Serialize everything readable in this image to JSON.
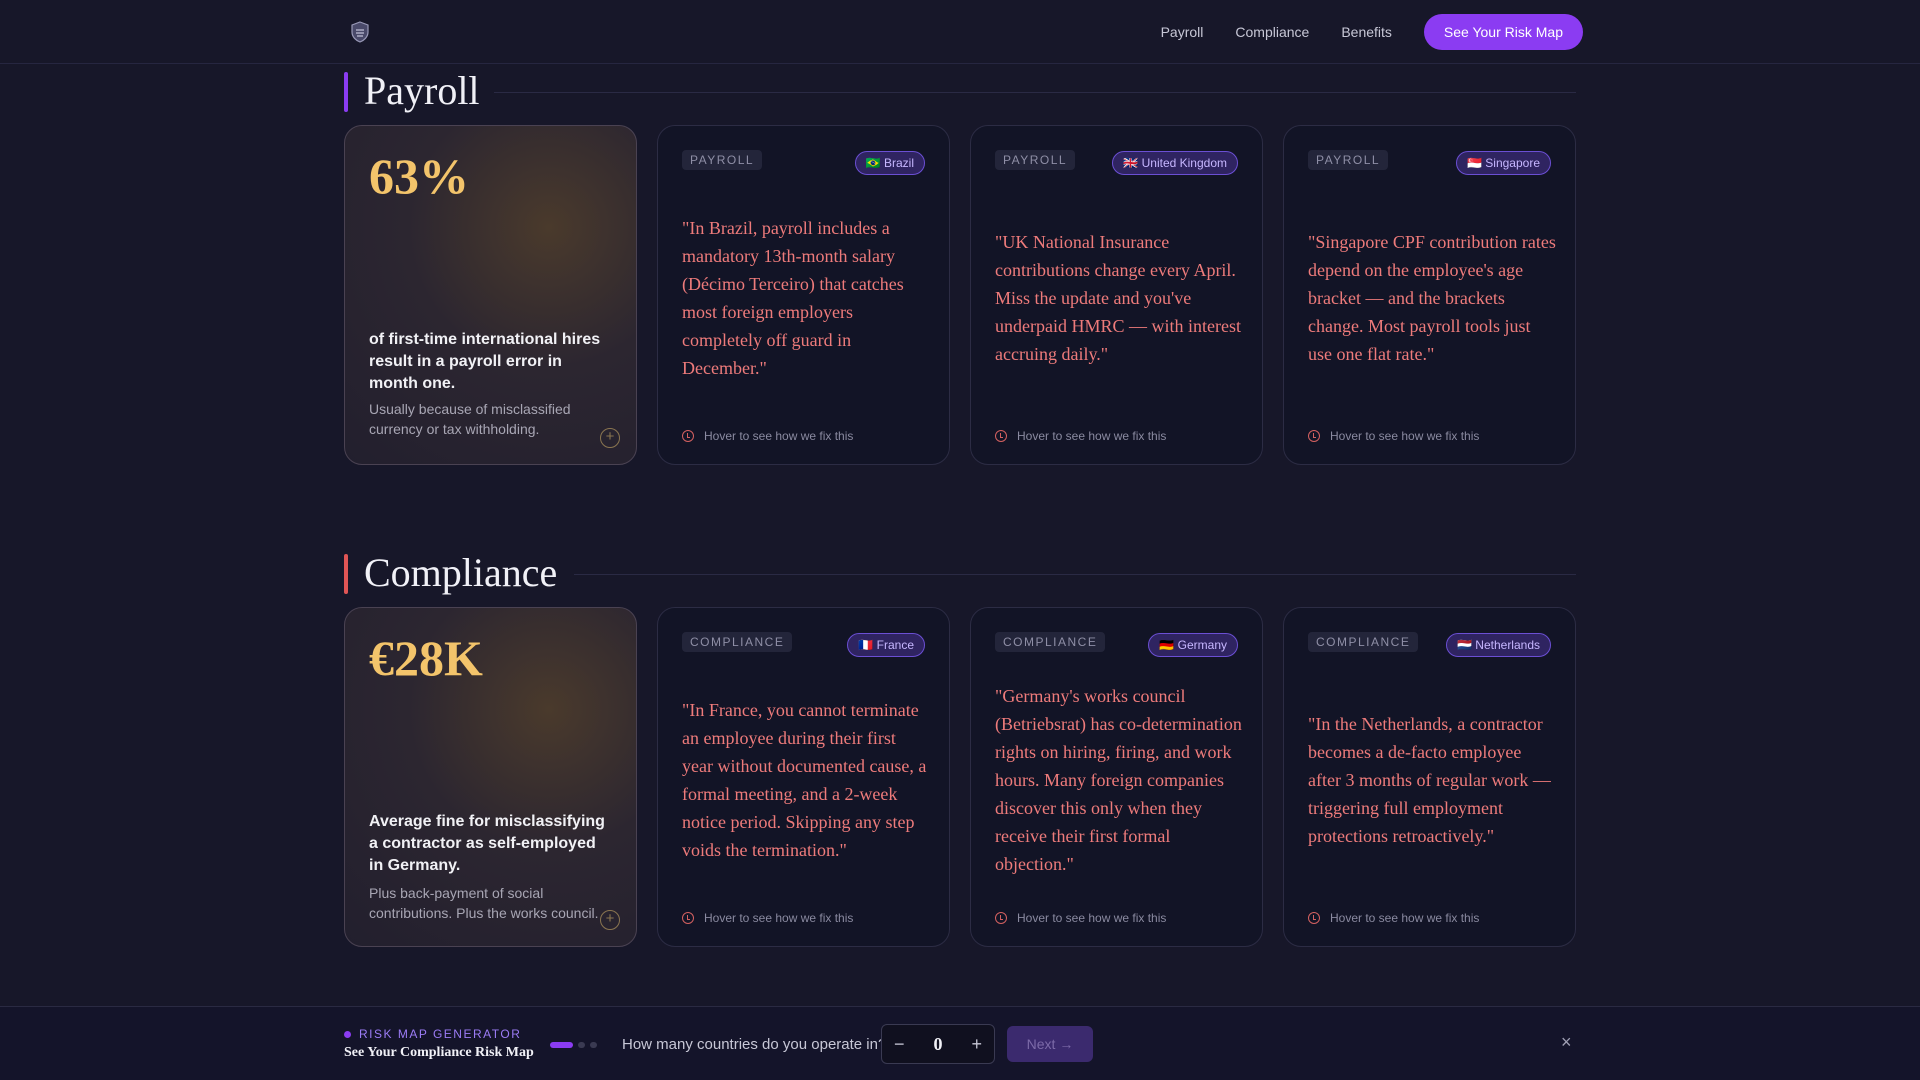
{
  "nav": {
    "logo": "shield-logo",
    "links": [
      "Payroll",
      "Compliance",
      "Benefits"
    ],
    "cta": "See Your Risk Map"
  },
  "colors": {
    "accent": "#8b3cf2",
    "payroll_bar": "#8b3cf2",
    "compliance_bar": "#e05555",
    "stat": "#f3c46b",
    "quote": "#ee7b7b"
  },
  "sections": [
    {
      "title": "Payroll",
      "stat": {
        "value": "63%",
        "description": "of first-time international hires result in a payroll error in month one.",
        "sub": "Usually because of misclassified currency or tax withholding."
      },
      "cards": [
        {
          "tag": "PAYROLL",
          "country": "🇧🇷 Brazil",
          "quote": "\"In Brazil, payroll includes a mandatory 13th-month salary (Décimo Terceiro) that catches most foreign employers completely off guard in December.\"",
          "hint": "Hover to see how we fix this"
        },
        {
          "tag": "PAYROLL",
          "country": "🇬🇧 United Kingdom",
          "quote": "\"UK National Insurance contributions change every April. Miss the update and you've underpaid HMRC — with interest accruing daily.\"",
          "hint": "Hover to see how we fix this"
        },
        {
          "tag": "PAYROLL",
          "country": "🇸🇬 Singapore",
          "quote": "\"Singapore CPF contribution rates depend on the employee's age bracket — and the brackets change. Most payroll tools just use one flat rate.\"",
          "hint": "Hover to see how we fix this"
        }
      ]
    },
    {
      "title": "Compliance",
      "stat": {
        "value": "€28K",
        "description": "Average fine for misclassifying a contractor as self-employed in Germany.",
        "sub": "Plus back-payment of social contributions. Plus the works council."
      },
      "cards": [
        {
          "tag": "COMPLIANCE",
          "country": "🇫🇷 France",
          "quote": "\"In France, you cannot terminate an employee during their first year without documented cause, a formal meeting, and a 2-week notice period. Skipping any step voids the termination.\"",
          "hint": "Hover to see how we fix this"
        },
        {
          "tag": "COMPLIANCE",
          "country": "🇩🇪 Germany",
          "quote": "\"Germany's works council (Betriebsrat) has co-determination rights on hiring, firing, and work hours. Many foreign companies discover this only when they receive their first formal objection.\"",
          "hint": "Hover to see how we fix this"
        },
        {
          "tag": "COMPLIANCE",
          "country": "🇳🇱 Netherlands",
          "quote": "\"In the Netherlands, a contractor becomes a de-facto employee after 3 months of regular work — triggering full employment protections retroactively.\"",
          "hint": "Hover to see how we fix this"
        }
      ]
    }
  ],
  "riskmap": {
    "label": "RISK MAP GENERATOR",
    "title": "See Your Compliance Risk Map",
    "question": "How many countries do you operate in?",
    "minus": "−",
    "value": "0",
    "plus": "+",
    "next": "Next →",
    "close": "×",
    "steps_total": 3,
    "step_current": 1
  }
}
